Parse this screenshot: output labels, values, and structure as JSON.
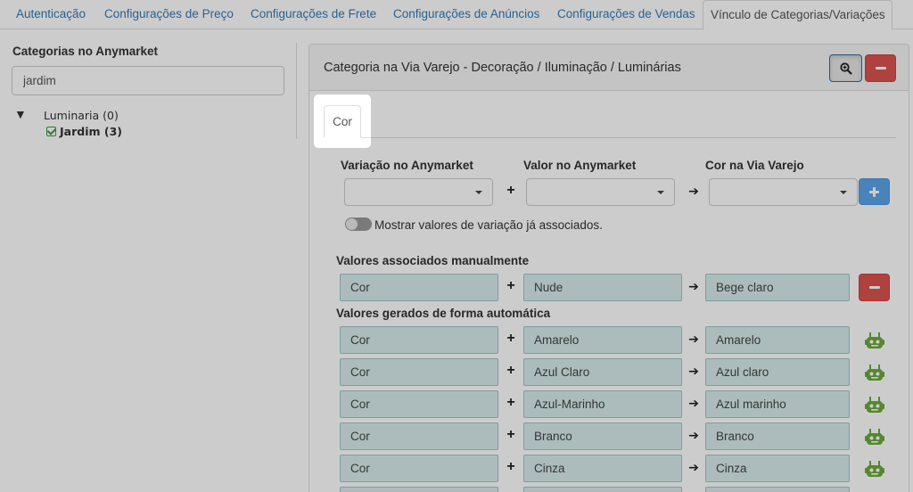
{
  "nav": {
    "tabs": [
      {
        "label": "Autenticação"
      },
      {
        "label": "Configurações de Preço"
      },
      {
        "label": "Configurações de Frete"
      },
      {
        "label": "Configurações de Anúncios"
      },
      {
        "label": "Configurações de Vendas"
      },
      {
        "label": "Vínculo de Categorias/Variações"
      }
    ]
  },
  "left": {
    "title": "Categorias no Anymarket",
    "search_value": "jardim",
    "tree": {
      "parent": "Luminaria (0)",
      "child": "Jardim (3)"
    }
  },
  "panel": {
    "title": "Categoria na Via Varejo - Decoração / Iluminação / Luminárias",
    "subtab": "Cor",
    "col_variation": "Variação no Anymarket",
    "col_value": "Valor no Anymarket",
    "col_target": "Cor na Via Varejo",
    "toggle_label": "Mostrar valores de variação já associados.",
    "manual_title": "Valores associados manualmente",
    "auto_title": "Valores gerados de forma automática",
    "manual_rows": [
      {
        "variation": "Cor",
        "value": "Nude",
        "target": "Bege claro"
      }
    ],
    "auto_rows": [
      {
        "variation": "Cor",
        "value": "Amarelo",
        "target": "Amarelo"
      },
      {
        "variation": "Cor",
        "value": "Azul Claro",
        "target": "Azul claro"
      },
      {
        "variation": "Cor",
        "value": "Azul-Marinho",
        "target": "Azul marinho"
      },
      {
        "variation": "Cor",
        "value": "Branco",
        "target": "Branco"
      },
      {
        "variation": "Cor",
        "value": "Cinza",
        "target": "Cinza"
      },
      {
        "variation": "",
        "value": "",
        "target": ""
      }
    ],
    "ops": {
      "plus": "+",
      "arrow": "➔"
    }
  },
  "colors": {
    "link": "#337ab7",
    "danger": "#d9534f",
    "primary_light": "#5ba6e8",
    "readonly_bg": "#d7ebeb",
    "robot": "#6aaa3a",
    "overlay": "rgba(0,0,0,0.2)"
  }
}
